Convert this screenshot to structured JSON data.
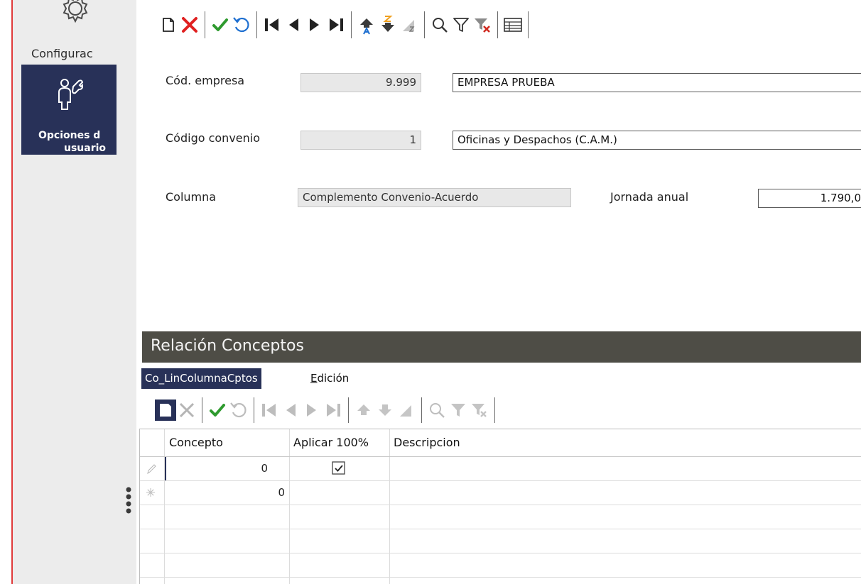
{
  "sidebar": {
    "config_label": "Configurac",
    "user_options_line1": "Opciones d",
    "user_options_line2": "usuario"
  },
  "toolbar_main": {
    "buttons": [
      "new",
      "delete",
      "accept",
      "undo",
      "first",
      "previous",
      "next",
      "last",
      "sort-ascending",
      "sort-descending",
      "sort-clear",
      "search",
      "filter",
      "filter-clear",
      "grid-view"
    ]
  },
  "form": {
    "empresa": {
      "label": "Cód. empresa",
      "code": "9.999",
      "name": "EMPRESA PRUEBA"
    },
    "convenio": {
      "label": "Código convenio",
      "code": "1",
      "name": "Oficinas y Despachos (C.A.M.)"
    },
    "columna": {
      "label": "Columna",
      "value": "Complemento Convenio-Acuerdo"
    },
    "jornada": {
      "label": "Jornada anual",
      "value": "1.790,0"
    }
  },
  "section": {
    "title": "Relación Conceptos"
  },
  "tabs": {
    "active": "Co_LinColumnaCptos",
    "edit_mnemonic": "E",
    "edit_rest": "dición"
  },
  "grid": {
    "columns": [
      "Concepto",
      "Aplicar 100%",
      "Descripcion"
    ],
    "rows": [
      {
        "indicator": "edit",
        "concepto": "0",
        "aplicar": true,
        "descripcion": ""
      },
      {
        "indicator": "new",
        "concepto": "0",
        "aplicar": false,
        "descripcion": ""
      }
    ]
  },
  "colors": {
    "accent_navy": "#283158",
    "section_bar": "#4e4d46",
    "delete_red": "#e02020",
    "accept_green": "#2e9a2e",
    "sort_blue": "#1e6fd0",
    "sort_orange": "#f0a020",
    "filter_red": "#d02a20"
  }
}
